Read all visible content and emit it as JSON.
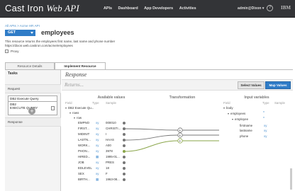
{
  "header": {
    "brand_main": "Cast Iron",
    "brand_italic": "Web API",
    "nav": [
      "APIs",
      "Dashboard",
      "App Developers",
      "Activities"
    ],
    "user": "admin@Dixon",
    "user_caret": "▾",
    "help_glyph": "?",
    "ibm": "IBM"
  },
  "breadcrumb": "All APIs  >  Acme HR API",
  "resource": {
    "method": "GET",
    "name": "employees",
    "description_line1": "This resource returns the employees first name, last name and phone number",
    "description_line2": "https://dixon.web.castiron.com/acme/employees",
    "proxy_label": "Proxy"
  },
  "tabs": [
    "Resource Details",
    "Implement Resource"
  ],
  "left_panel": {
    "title": "Tasks",
    "request": "Request",
    "query_box": "DB2 Execute Query",
    "query_box2_line1": "DB2",
    "query_box2_line2": "EXECUTE QUERY",
    "response": "Response",
    "plus": "+"
  },
  "right_panel": {
    "title": "Response",
    "returns": "Returns...",
    "select_values": "Select Values",
    "map_values": "Map Values",
    "available_values": "Available values",
    "transformation": "Transformation",
    "input_variables": "Input variables",
    "col_field": "Field",
    "col_type": "Type",
    "col_sample": "Sample"
  },
  "available_rows": [
    {
      "field": "DB2 Execute Qu...",
      "type": "",
      "sample": ""
    },
    {
      "field": "rows",
      "type": "",
      "sample": ""
    },
    {
      "field": "row",
      "type": "",
      "sample": ""
    },
    {
      "field": "EMPNO",
      "type": "xy",
      "sample": "000010"
    },
    {
      "field": "FIRST...",
      "type": "xy",
      "sample": "CHRISTI..."
    },
    {
      "field": "MIDINIT",
      "type": "xy",
      "sample": "I"
    },
    {
      "field": "LASTN...",
      "type": "xy",
      "sample": "HAAS"
    },
    {
      "field": "WORK...",
      "type": "xy",
      "sample": "A00"
    },
    {
      "field": "PHON...",
      "type": "xy",
      "sample": "3978"
    },
    {
      "field": "HIRED...",
      "type": "cal",
      "sample": "1995-01..."
    },
    {
      "field": "JOB",
      "type": "xy",
      "sample": "PRES"
    },
    {
      "field": "EDLEVEL",
      "type": "xy",
      "sample": "18"
    },
    {
      "field": "SEX",
      "type": "xy",
      "sample": "F"
    },
    {
      "field": "BIRTH...",
      "type": "cal",
      "sample": "1963-08..."
    }
  ],
  "input_rows": [
    {
      "field": "body",
      "type": ""
    },
    {
      "field": "employees",
      "type": "*"
    },
    {
      "field": "employee",
      "type": "*"
    },
    {
      "field": "firstname",
      "type": "xy"
    },
    {
      "field": "lastname",
      "type": "xy"
    },
    {
      "field": "phone",
      "type": "xy"
    }
  ],
  "transformation_nodes": [
    "+",
    "+",
    "+"
  ],
  "colors": {
    "header_bg": "#333437",
    "primary": "#2f7cc7",
    "link": "#4c8fc8",
    "connector": "#777777",
    "connector_active": "#8aa54a"
  }
}
